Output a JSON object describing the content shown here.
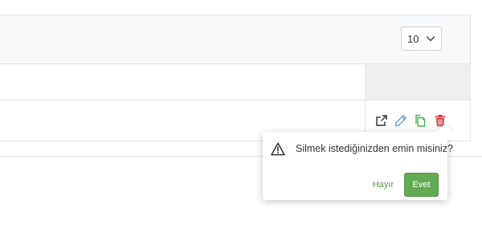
{
  "table": {
    "page_size": {
      "selected": "10"
    },
    "row_actions": [
      {
        "icon": "external-link-icon",
        "color": "#333333"
      },
      {
        "icon": "pencil-icon",
        "color": "#5b9bd5"
      },
      {
        "icon": "copy-icon",
        "color": "#4caf50"
      },
      {
        "icon": "trash-icon",
        "color": "#d64541"
      }
    ]
  },
  "confirm_popover": {
    "icon": "warning-icon",
    "message": "Silmek istediğinizden emin misiniz?",
    "cancel_label": "Hayır",
    "confirm_label": "Evet",
    "accent_color": "#63ab53"
  }
}
